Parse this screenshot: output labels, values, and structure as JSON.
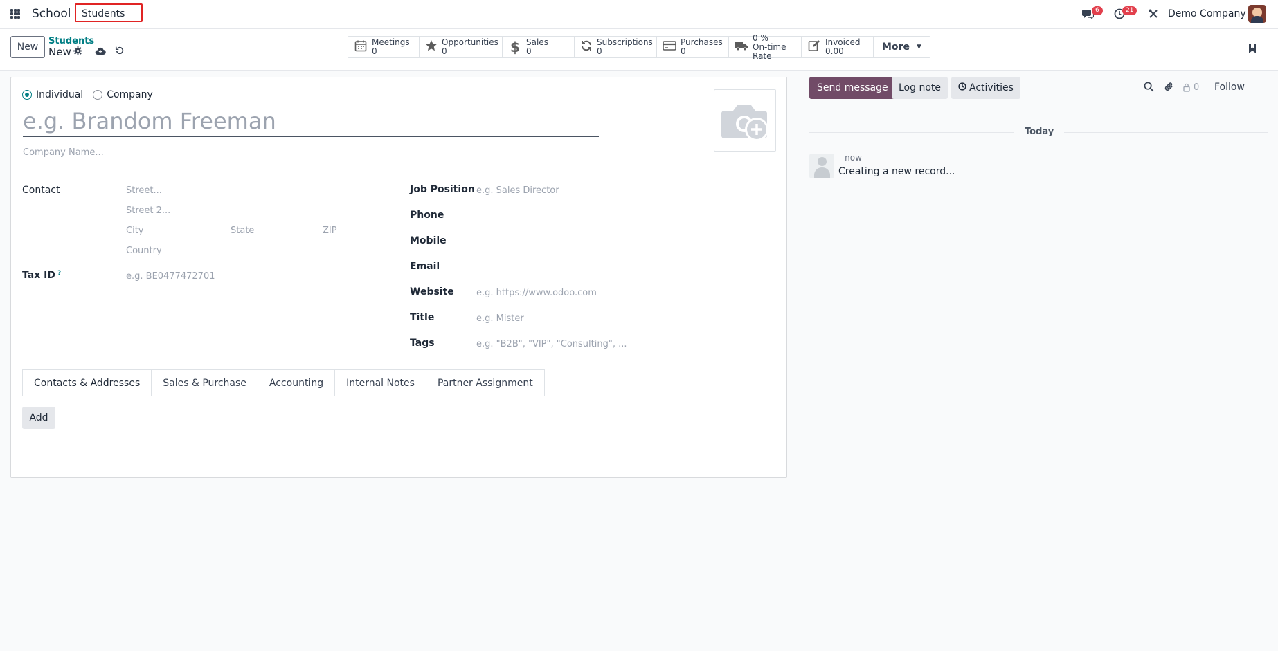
{
  "navbar": {
    "brand": "School",
    "menu_item": "Students",
    "messages_badge": "6",
    "activities_badge": "21",
    "company": "Demo Company"
  },
  "control": {
    "new_label": "New",
    "breadcrumb_parent": "Students",
    "breadcrumb_current": "New",
    "stats": [
      {
        "icon": "calendar-icon",
        "label": "Meetings",
        "value": "0"
      },
      {
        "icon": "star-icon",
        "label": "Opportunities",
        "value": "0"
      },
      {
        "icon": "dollar-icon",
        "label": "Sales",
        "value": "0"
      },
      {
        "icon": "refresh-icon",
        "label": "Subscriptions",
        "value": "0"
      },
      {
        "icon": "credit-card-icon",
        "label": "Purchases",
        "value": "0"
      },
      {
        "icon": "truck-icon",
        "label": "0 %",
        "value": "On-time Rate"
      },
      {
        "icon": "edit-icon",
        "label": "Invoiced",
        "value": "0.00"
      }
    ],
    "more_label": "More"
  },
  "form": {
    "radio_individual": "Individual",
    "radio_company": "Company",
    "name_placeholder": "e.g. Brandom Freeman",
    "company_name_placeholder": "Company Name...",
    "contact_label": "Contact",
    "street_placeholder": "Street...",
    "street2_placeholder": "Street 2...",
    "city_placeholder": "City",
    "state_placeholder": "State",
    "zip_placeholder": "ZIP",
    "country_placeholder": "Country",
    "tax_id_label": "Tax ID",
    "tax_id_help": "?",
    "tax_id_placeholder": "e.g. BE0477472701",
    "job_position_label": "Job Position",
    "job_position_placeholder": "e.g. Sales Director",
    "phone_label": "Phone",
    "mobile_label": "Mobile",
    "email_label": "Email",
    "website_label": "Website",
    "website_placeholder": "e.g. https://www.odoo.com",
    "title_label": "Title",
    "title_placeholder": "e.g. Mister",
    "tags_label": "Tags",
    "tags_placeholder": "e.g. \"B2B\", \"VIP\", \"Consulting\", ..."
  },
  "tabs": [
    "Contacts & Addresses",
    "Sales & Purchase",
    "Accounting",
    "Internal Notes",
    "Partner Assignment"
  ],
  "add_label": "Add",
  "chatter": {
    "send_message": "Send message",
    "log_note": "Log note",
    "activities": "Activities",
    "follower_count": "0",
    "follow": "Follow",
    "today": "Today",
    "message_time": "- now",
    "message_body": "Creating a new record..."
  },
  "colors": {
    "primary": "#714b67",
    "accent_teal": "#017e84",
    "badge_red": "#e2404d",
    "highlight_box": "#e02424"
  }
}
